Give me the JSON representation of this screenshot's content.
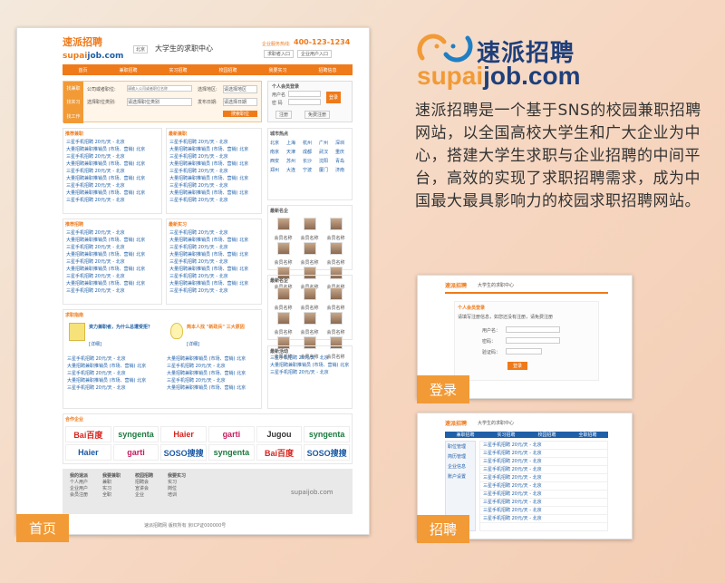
{
  "brand": {
    "name_cn": "速派招聘",
    "domain_sup": "supai",
    "domain_rest": "job.com",
    "description": "速派招聘是一个基于SNS的校园兼职招聘网站，以全国高校大学生和广大企业为中心，搭建大学生求职与企业招聘的中间平台，高效的实现了求职招聘需求，成为中国最大最具影响力的校园求职招聘网站。",
    "colors": {
      "orange": "#ef7a1a",
      "blue": "#1f5fa8",
      "tag": "#f29a35"
    }
  },
  "labels": {
    "home": "首页",
    "login": "登录",
    "recruit": "招聘"
  },
  "home_page": {
    "slogan": "大学生的求职中心",
    "city": "北京",
    "hotline_label": "企业服务热线:",
    "hotline": "400-123-1234",
    "nav": [
      "首页",
      "兼职招聘",
      "实习招聘",
      "校园招聘",
      "我要实习",
      "招聘信息"
    ],
    "quick_links": [
      "求职者入口",
      "企业用户入口"
    ],
    "search": {
      "tabs": [
        "找兼职",
        "找实习",
        "找工作"
      ],
      "company_label": "公司或者职位:",
      "company_placeholder": "请输入公司或者职位名称",
      "city_label": "选择地区:",
      "city_value": "请选择地区",
      "type_label": "选择职位类别:",
      "type_value": "请选择职位类别",
      "date_label": "发布日期:",
      "date_value": "请选择日期",
      "search_button": "搜索职位"
    },
    "login_box": {
      "title": "个人会员登录",
      "user_label": "用户名",
      "pass_label": "密 码",
      "login_button": "登录",
      "register_button": "注册",
      "free_button": "免费注册"
    },
    "sections": [
      {
        "title": "推荐兼职",
        "more": "更多>>"
      },
      {
        "title": "最新兼职",
        "more": "更多>>"
      },
      {
        "title": "推荐招聘",
        "more": "更多>>"
      },
      {
        "title": "最新实习",
        "more": "更多>>"
      }
    ],
    "job_line_a": "三星手机招聘 20元/天 - 北京",
    "job_line_b": "大量招聘兼职推销员 (市场、营销) 北京",
    "hot_cities_title": "城市热点",
    "cities": [
      "北京",
      "上海",
      "杭州",
      "广州",
      "深圳",
      "南京",
      "天津",
      "成都",
      "武汉",
      "重庆",
      "西安",
      "苏州",
      "长沙",
      "沈阳",
      "青岛",
      "郑州",
      "大连",
      "宁波",
      "厦门",
      "济南"
    ],
    "talents_title": "最新名企",
    "talents2_title": "最新名企",
    "photo_caption": "会员名称",
    "advice_title": "求职指南",
    "advice_more": "更多>>",
    "article1_title": "资力兼职者，为什么总遭受拒？",
    "article2_title": "简本人找 \"新政兵\" 三大原因",
    "article_more": "[详细]",
    "notice_title": "最新活动",
    "partners_title": "合作企业",
    "partners": [
      {
        "name": "Bai百度",
        "color": "#d7231d"
      },
      {
        "name": "syngenta",
        "color": "#1b7a3e"
      },
      {
        "name": "Haier",
        "color": "#d7231d"
      },
      {
        "name": "garti",
        "color": "#c51c5e"
      },
      {
        "name": "Jugou",
        "color": "#333333"
      },
      {
        "name": "syngenta",
        "color": "#1b7a3e"
      },
      {
        "name": "Haier",
        "color": "#1c5aa6"
      },
      {
        "name": "garti",
        "color": "#c51c5e"
      },
      {
        "name": "SOSO搜搜",
        "color": "#1c5aa6"
      },
      {
        "name": "syngenta",
        "color": "#1b7a3e"
      },
      {
        "name": "Bai百度",
        "color": "#d7231d"
      },
      {
        "name": "SOSO搜搜",
        "color": "#1c5aa6"
      }
    ],
    "footer_cols": [
      {
        "title": "我的速派",
        "items": [
          "个人用户",
          "企业用户",
          "会员注册"
        ]
      },
      {
        "title": "我要兼职",
        "items": [
          "兼职",
          "实习",
          "全职"
        ]
      },
      {
        "title": "校园招聘",
        "items": [
          "招聘会",
          "宣讲会",
          "企业"
        ]
      },
      {
        "title": "我要实习",
        "items": [
          "实习",
          "岗位",
          "培训"
        ]
      }
    ],
    "footer_logo": "supaijob.com",
    "copyright": "速派招聘网 版权所有  京ICP证000000号"
  },
  "login_page": {
    "slogan": "大学生的求职中心",
    "title": "个人会员登录",
    "notice": "请填写注册信息，如您还没有注册，请免费注册",
    "fields": [
      "用户名：",
      "密码：",
      "验证码："
    ],
    "login_button": "登录"
  },
  "recruit_page": {
    "slogan": "大学生的求职中心",
    "sidebar": [
      "职位管理",
      "简历管理",
      "企业信息",
      "账户设置"
    ],
    "tabs": [
      "兼职招聘",
      "实习招聘",
      "校园招聘",
      "全职招聘"
    ]
  }
}
